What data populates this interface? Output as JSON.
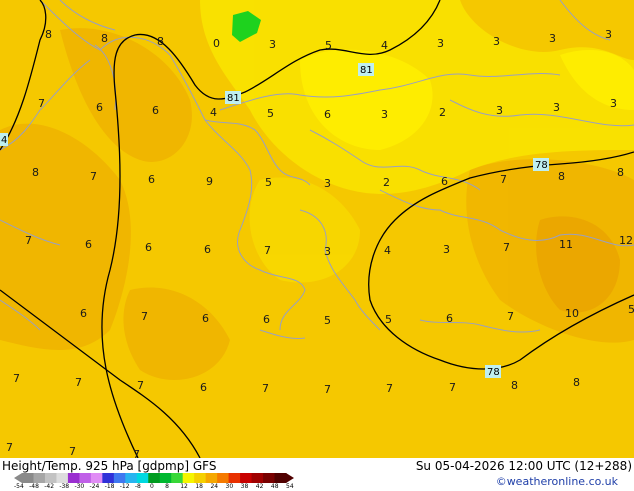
{
  "footer": {
    "title": "Height/Temp. 925 hPa [gdpmp] GFS",
    "datetime": "Su 05-04-2026 12:00 UTC (12+288)",
    "credit": "©weatheronline.co.uk"
  },
  "colorbar": {
    "colors": [
      "#8a8a8a",
      "#a6a6a6",
      "#c2c2c2",
      "#dddddd",
      "#9a2fd0",
      "#c060e8",
      "#e08cf5",
      "#3030d8",
      "#3f78f0",
      "#28b4f0",
      "#00d8e0",
      "#009b20",
      "#00b830",
      "#38d838",
      "#f5f500",
      "#f5d000",
      "#f5a800",
      "#f57a00",
      "#e83000",
      "#c80000",
      "#a00000",
      "#780000",
      "#500000"
    ],
    "ticks": [
      "-54",
      "-48",
      "-42",
      "-38",
      "-30",
      "-24",
      "-18",
      "-12",
      "-8",
      "0",
      "8",
      "12",
      "18",
      "24",
      "30",
      "38",
      "42",
      "48",
      "54"
    ]
  },
  "map": {
    "contour_labels": [
      "81",
      "81",
      "78",
      "78",
      "4"
    ],
    "temps": [
      "8",
      "8",
      "8",
      "0",
      "3",
      "5",
      "4",
      "3",
      "3",
      "3",
      "3",
      "7",
      "6",
      "6",
      "4",
      "5",
      "6",
      "3",
      "2",
      "3",
      "3",
      "3",
      "8",
      "7",
      "6",
      "9",
      "5",
      "3",
      "2",
      "6",
      "7",
      "8",
      "8",
      "7",
      "6",
      "6",
      "6",
      "7",
      "3",
      "4",
      "3",
      "7",
      "11",
      "12",
      "6",
      "7",
      "6",
      "6",
      "5",
      "5",
      "6",
      "7",
      "10",
      "5",
      "7",
      "7",
      "7",
      "6",
      "7",
      "7",
      "7",
      "7",
      "8",
      "8",
      "7",
      "7",
      "7"
    ]
  }
}
